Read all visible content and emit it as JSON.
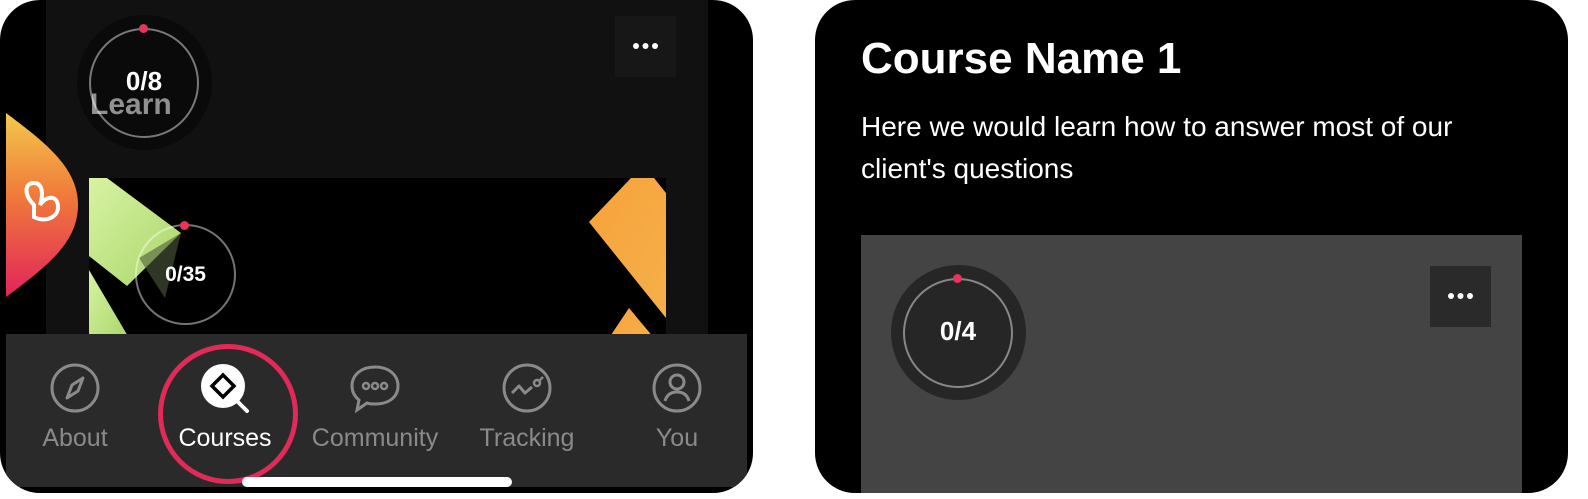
{
  "left_screen": {
    "course_card": {
      "progress": "0/8",
      "progress_fraction": 0.0,
      "title_partial": "Learn",
      "more_label": "..."
    },
    "second_card": {
      "progress": "0/35",
      "progress_fraction": 0.0
    },
    "nav": {
      "items": [
        {
          "label": "About",
          "icon": "compass-icon"
        },
        {
          "label": "Courses",
          "icon": "courses-icon",
          "active": true
        },
        {
          "label": "Community",
          "icon": "chat-bubble-icon"
        },
        {
          "label": "Tracking",
          "icon": "tracking-chart-icon"
        },
        {
          "label": "You",
          "icon": "user-icon"
        }
      ]
    },
    "colors": {
      "accent": "#e8335a",
      "nav_bg": "#2a2a2a",
      "card_bg": "#111111"
    }
  },
  "right_screen": {
    "course_title": "Course Name 1",
    "course_description": "Here we would learn how to answer most of our client's questions",
    "card": {
      "progress": "0/4",
      "progress_fraction": 0.0,
      "more_label": "...",
      "card_bg": "#444444"
    }
  }
}
